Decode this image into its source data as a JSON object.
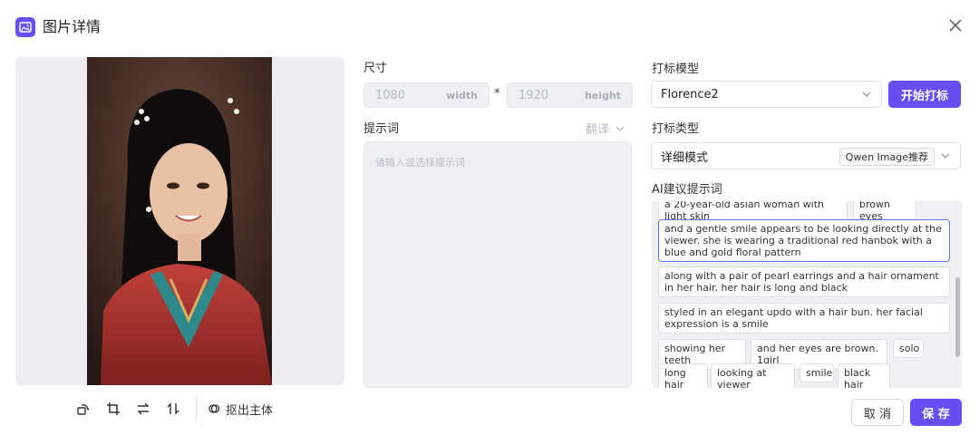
{
  "header": {
    "title": "图片详情"
  },
  "toolbar": {
    "cutout_label": "抠出主体"
  },
  "size": {
    "label": "尺寸",
    "width_value": "1080",
    "width_unit": "width",
    "times": "*",
    "height_value": "1920",
    "height_unit": "height"
  },
  "prompt": {
    "label": "提示词",
    "translate_label": "翻译",
    "placeholder": "请输入或选择提示词"
  },
  "tagging": {
    "model_label": "打标模型",
    "model_value": "Florence2",
    "start_button": "开始打标",
    "type_label": "打标类型",
    "type_value": "详细模式",
    "type_badge": "Qwen Image推荐"
  },
  "ai_suggest": {
    "label": "AI建议提示词",
    "chips": [
      "a 20-year-old asian woman with light skin",
      "brown eyes",
      "and a gentle smile appears to be looking directly at the viewer. she is wearing a traditional red hanbok with a blue and gold floral pattern",
      "along with a pair of pearl earrings and a hair ornament in her hair. her hair is long and black",
      "styled in an elegant updo with a hair bun. her facial expression is a smile",
      "showing her teeth",
      "and her eyes are brown. 1girl",
      "solo",
      "long hair",
      "looking at viewer",
      "smile",
      "black hair"
    ]
  },
  "footer": {
    "cancel": "取 消",
    "save": "保 存"
  },
  "colors": {
    "accent": "#6a4cf5",
    "panel": "#eef0f4"
  }
}
